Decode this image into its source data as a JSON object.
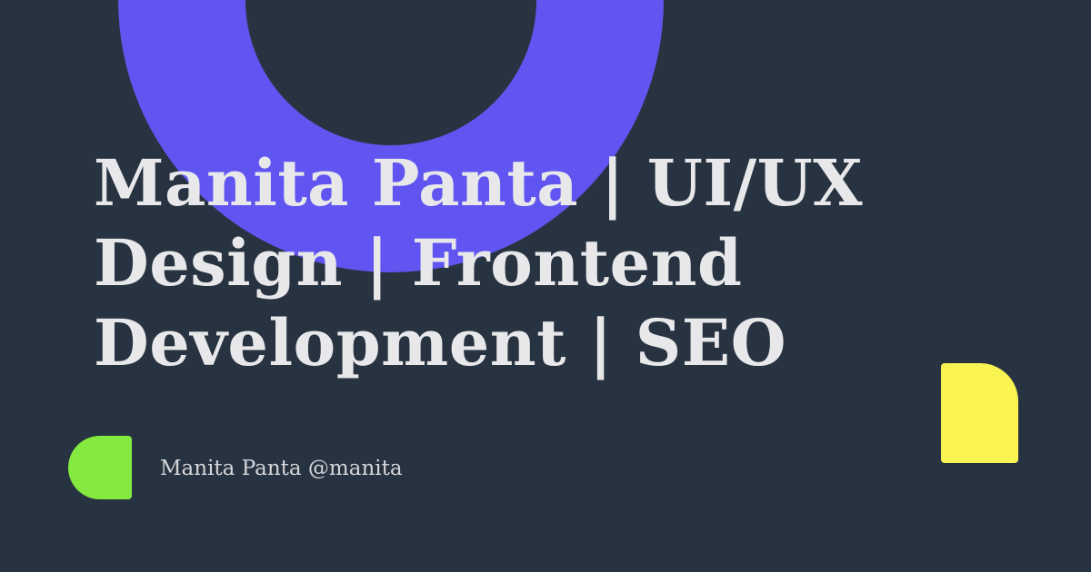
{
  "card": {
    "title": "Manita Panta | UI/UX Design | Frontend Development | SEO",
    "byline": "Manita Panta @manita"
  },
  "colors": {
    "background": "#283341",
    "accent_purple": "#6055f0",
    "accent_yellow": "#f9f451",
    "accent_green": "#84ea40",
    "text_primary": "#e8e8ea",
    "text_secondary": "#d4d6d9"
  }
}
